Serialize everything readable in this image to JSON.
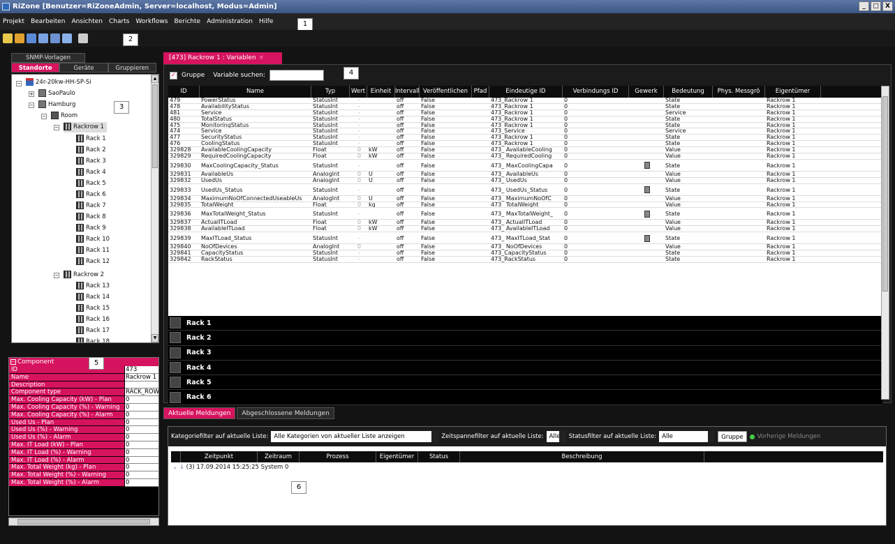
{
  "window": {
    "title": "RiZone [Benutzer=RiZoneAdmin, Server=localhost, Modus=Admin]",
    "controls": [
      "_",
      "□",
      "X"
    ]
  },
  "menu": [
    "Projekt",
    "Bearbeiten",
    "Ansichten",
    "Charts",
    "Workflows",
    "Berichte",
    "Administration",
    "Hilfe"
  ],
  "callouts": [
    "1",
    "2",
    "3",
    "4",
    "5",
    "6"
  ],
  "toolbar_icons": [
    "new-icon",
    "open-icon",
    "save-icon",
    "export-icon",
    "import-icon",
    "sync-icon",
    "network-icon"
  ],
  "left": {
    "snmp_tab": "SNMP-Vorlagen",
    "tabs": [
      {
        "label": "Standorte",
        "active": true
      },
      {
        "label": "Geräte",
        "active": false
      },
      {
        "label": "Gruppieren",
        "active": false
      }
    ],
    "tree": {
      "root": "24r-20kw-HH-SP-Si",
      "saopaulo": "SaoPaulo",
      "hamburg": "Hamburg",
      "room": "Room",
      "rackrow1": "Rackrow 1",
      "rackrow2": "Rackrow 2",
      "racks1": [
        "Rack 1",
        "Rack 2",
        "Rack 3",
        "Rack 4",
        "Rack 5",
        "Rack 6",
        "Rack 7",
        "Rack 8",
        "Rack 9",
        "Rack 10",
        "Rack 11",
        "Rack 12"
      ],
      "racks2": [
        "Rack 13",
        "Rack 14",
        "Rack 15",
        "Rack 16",
        "Rack 17",
        "Rack 18"
      ]
    },
    "properties": {
      "header": "Component",
      "rows": [
        {
          "k": "ID",
          "v": "473"
        },
        {
          "k": "Name",
          "v": "Rackrow 1"
        },
        {
          "k": "Description",
          "v": ""
        },
        {
          "k": "Component type",
          "v": "RACK_ROW"
        },
        {
          "k": "Max. Cooling Capacity (kW) - Plan",
          "v": "0"
        },
        {
          "k": "Max. Cooling Capacity (%) - Warning",
          "v": "0"
        },
        {
          "k": "Max. Cooling Capacity (%) - Alarm",
          "v": "0"
        },
        {
          "k": "Used Us - Plan",
          "v": "0"
        },
        {
          "k": "Used Us (%) - Warning",
          "v": "0"
        },
        {
          "k": "Used Us (%) - Alarm",
          "v": "0"
        },
        {
          "k": "Max. IT Load (kW) - Plan",
          "v": "0"
        },
        {
          "k": "Max. IT Load (%) - Warning",
          "v": "0"
        },
        {
          "k": "Max. IT Load (%) - Alarm",
          "v": "0"
        },
        {
          "k": "Max. Total Weight (kg) - Plan",
          "v": "0"
        },
        {
          "k": "Max. Total Weight (%) - Warning",
          "v": "0"
        },
        {
          "k": "Max. Total Weight (%) - Alarm",
          "v": "0"
        }
      ]
    }
  },
  "main": {
    "tab_title": "[473] Rackrow 1 : Variablen",
    "tab_close": "×",
    "gruppe_label": "Gruppe",
    "search_label": "Variable suchen:",
    "search_value": "",
    "columns": [
      "ID",
      "Name",
      "Typ",
      "Wert",
      "Einheit",
      "Intervall",
      "Veröffentlichen",
      "Pfad",
      "Eindeutige ID",
      "Verbindungs ID",
      "Gewerk",
      "Bedeutung",
      "Phys. Messgrö",
      "Eigentümer"
    ],
    "rows": [
      {
        "id": "479",
        "name": "PowerStatus",
        "typ": "StatusInt",
        "wert": "-",
        "einheit": "",
        "intervall": "off",
        "pub": "False",
        "uid": "473_Rackrow 1",
        "conn": "0",
        "gewerk": false,
        "bed": "State",
        "own": "Rackrow 1",
        "tall": false
      },
      {
        "id": "478",
        "name": "AvailabilityStatus",
        "typ": "StatusInt",
        "wert": "-",
        "einheit": "",
        "intervall": "off",
        "pub": "False",
        "uid": "473_Rackrow 1",
        "conn": "0",
        "gewerk": false,
        "bed": "State",
        "own": "Rackrow 1",
        "tall": false
      },
      {
        "id": "481",
        "name": "Service",
        "typ": "StatusInt",
        "wert": "-",
        "einheit": "",
        "intervall": "off",
        "pub": "False",
        "uid": "473_Rackrow 1",
        "conn": "0",
        "gewerk": false,
        "bed": "Service",
        "own": "Rackrow 1",
        "tall": false
      },
      {
        "id": "480",
        "name": "TotalStatus",
        "typ": "StatusInt",
        "wert": "-",
        "einheit": "",
        "intervall": "off",
        "pub": "False",
        "uid": "473_Rackrow 1",
        "conn": "0",
        "gewerk": false,
        "bed": "State",
        "own": "Rackrow 1",
        "tall": false
      },
      {
        "id": "475",
        "name": "MonitoringStatus",
        "typ": "StatusInt",
        "wert": "-",
        "einheit": "",
        "intervall": "off",
        "pub": "False",
        "uid": "473_Rackrow 1",
        "conn": "0",
        "gewerk": false,
        "bed": "State",
        "own": "Rackrow 1",
        "tall": false
      },
      {
        "id": "474",
        "name": "Service",
        "typ": "StatusInt",
        "wert": "-",
        "einheit": "",
        "intervall": "off",
        "pub": "False",
        "uid": "473_Service",
        "conn": "0",
        "gewerk": false,
        "bed": "Service",
        "own": "Rackrow 1",
        "tall": false
      },
      {
        "id": "477",
        "name": "SecurityStatus",
        "typ": "StatusInt",
        "wert": "-",
        "einheit": "",
        "intervall": "off",
        "pub": "False",
        "uid": "473_Rackrow 1",
        "conn": "0",
        "gewerk": false,
        "bed": "State",
        "own": "Rackrow 1",
        "tall": false
      },
      {
        "id": "476",
        "name": "CoolingStatus",
        "typ": "StatusInt",
        "wert": "-",
        "einheit": "",
        "intervall": "off",
        "pub": "False",
        "uid": "473_Rackrow 1",
        "conn": "0",
        "gewerk": false,
        "bed": "State",
        "own": "Rackrow 1",
        "tall": false
      },
      {
        "id": "329828",
        "name": "AvailableCoolingCapacity",
        "typ": "Float",
        "wert": "0",
        "einheit": "kW",
        "intervall": "off",
        "pub": "False",
        "uid": "473_ AvailableCooling",
        "conn": "0",
        "gewerk": false,
        "bed": "Value",
        "own": "Rackrow 1",
        "tall": false
      },
      {
        "id": "329829",
        "name": "RequiredCoolingCapacity",
        "typ": "Float",
        "wert": "0",
        "einheit": "kW",
        "intervall": "off",
        "pub": "False",
        "uid": "473_ RequiredCooling",
        "conn": "0",
        "gewerk": false,
        "bed": "Value",
        "own": "Rackrow 1",
        "tall": false
      },
      {
        "id": "329830",
        "name": "MaxCoolingCapacity_Status",
        "typ": "StatusInt",
        "wert": "-",
        "einheit": "",
        "intervall": "off",
        "pub": "False",
        "uid": "473_ MaxCoolingCapa",
        "conn": "0",
        "gewerk": true,
        "bed": "State",
        "own": "Rackrow 1",
        "tall": true
      },
      {
        "id": "329831",
        "name": "AvailableUs",
        "typ": "AnalogInt",
        "wert": "0",
        "einheit": "U",
        "intervall": "off",
        "pub": "False",
        "uid": "473_ AvailableUs",
        "conn": "0",
        "gewerk": false,
        "bed": "Value",
        "own": "Rackrow 1",
        "tall": false
      },
      {
        "id": "329832",
        "name": "UsedUs",
        "typ": "AnalogInt",
        "wert": "0",
        "einheit": "U",
        "intervall": "off",
        "pub": "False",
        "uid": "473_ UsedUs",
        "conn": "0",
        "gewerk": false,
        "bed": "Value",
        "own": "Rackrow 1",
        "tall": false
      },
      {
        "id": "329833",
        "name": "UsedUs_Status",
        "typ": "StatusInt",
        "wert": "-",
        "einheit": "",
        "intervall": "off",
        "pub": "False",
        "uid": "473_ UsedUs_Status",
        "conn": "0",
        "gewerk": true,
        "bed": "State",
        "own": "Rackrow 1",
        "tall": true
      },
      {
        "id": "329834",
        "name": "MaximumNoOfConnectedUseableUs",
        "typ": "AnalogInt",
        "wert": "0",
        "einheit": "U",
        "intervall": "off",
        "pub": "False",
        "uid": "473_ MaximumNoOfC",
        "conn": "0",
        "gewerk": false,
        "bed": "Value",
        "own": "Rackrow 1",
        "tall": false
      },
      {
        "id": "329835",
        "name": "TotalWeight",
        "typ": "Float",
        "wert": "0",
        "einheit": "kg",
        "intervall": "off",
        "pub": "False",
        "uid": "473_ TotalWeight",
        "conn": "0",
        "gewerk": false,
        "bed": "Value",
        "own": "Rackrow 1",
        "tall": false
      },
      {
        "id": "329836",
        "name": "MaxTotalWeight_Status",
        "typ": "StatusInt",
        "wert": "-",
        "einheit": "",
        "intervall": "off",
        "pub": "False",
        "uid": "473_ MaxTotalWeight_",
        "conn": "0",
        "gewerk": true,
        "bed": "State",
        "own": "Rackrow 1",
        "tall": true
      },
      {
        "id": "329837",
        "name": "ActualITLoad",
        "typ": "Float",
        "wert": "0",
        "einheit": "kW",
        "intervall": "off",
        "pub": "False",
        "uid": "473_ ActualITLoad",
        "conn": "0",
        "gewerk": false,
        "bed": "Value",
        "own": "Rackrow 1",
        "tall": false
      },
      {
        "id": "329838",
        "name": "AvailableITLoad",
        "typ": "Float",
        "wert": "0",
        "einheit": "kW",
        "intervall": "off",
        "pub": "False",
        "uid": "473_ AvailableITLoad",
        "conn": "0",
        "gewerk": false,
        "bed": "Value",
        "own": "Rackrow 1",
        "tall": false
      },
      {
        "id": "329839",
        "name": "MaxITLoad_Status",
        "typ": "StatusInt",
        "wert": "-",
        "einheit": "",
        "intervall": "off",
        "pub": "False",
        "uid": "473_ MaxITLoad_Stat",
        "conn": "0",
        "gewerk": true,
        "bed": "State",
        "own": "Rackrow 1",
        "tall": true
      },
      {
        "id": "329840",
        "name": "NoOfDevices",
        "typ": "AnalogInt",
        "wert": "0",
        "einheit": "",
        "intervall": "off",
        "pub": "False",
        "uid": "473_ NoOfDevices",
        "conn": "0",
        "gewerk": false,
        "bed": "Value",
        "own": "Rackrow 1",
        "tall": false
      },
      {
        "id": "329841",
        "name": "CapacityStatus",
        "typ": "StatusInt",
        "wert": "-",
        "einheit": "",
        "intervall": "off",
        "pub": "False",
        "uid": "473_CapacityStatus",
        "conn": "0",
        "gewerk": false,
        "bed": "State",
        "own": "Rackrow 1",
        "tall": false
      },
      {
        "id": "329842",
        "name": "RackStatus",
        "typ": "StatusInt",
        "wert": "-",
        "einheit": "",
        "intervall": "off",
        "pub": "False",
        "uid": "473_RackStatus",
        "conn": "0",
        "gewerk": false,
        "bed": "State",
        "own": "Rackrow 1",
        "tall": false
      }
    ],
    "groups": [
      "Rack 1",
      "Rack 2",
      "Rack 3",
      "Rack 4",
      "Rack 5",
      "Rack 6"
    ]
  },
  "bottom": {
    "tabs": [
      {
        "label": "Aktuelle Meldungen",
        "active": true
      },
      {
        "label": "Abgeschlossene Meldungen",
        "active": false
      }
    ],
    "kat_label": "Kategoriefilter auf aktuelle Liste:",
    "kat_value": "Alle Kategorien von aktueller Liste anzeigen",
    "zeit_label": "Zeitspannefilter auf aktuelle Liste:",
    "zeit_value": "Alle",
    "status_label": "Statusfilter auf aktuelle Liste:",
    "status_value": "Alle",
    "gruppe_btn": "Gruppe",
    "prev_btn": "Vorherige Meldungen",
    "columns": [
      "Zeitpunkt",
      "Zeitraum",
      "Prozess",
      "Eigentümer",
      "Status",
      "Beschreibung"
    ],
    "row": "(3) 17.09.2014 15:25:25  System  0"
  },
  "colors": {
    "accent": "#d6135f",
    "panel": "#1b1b1b"
  }
}
